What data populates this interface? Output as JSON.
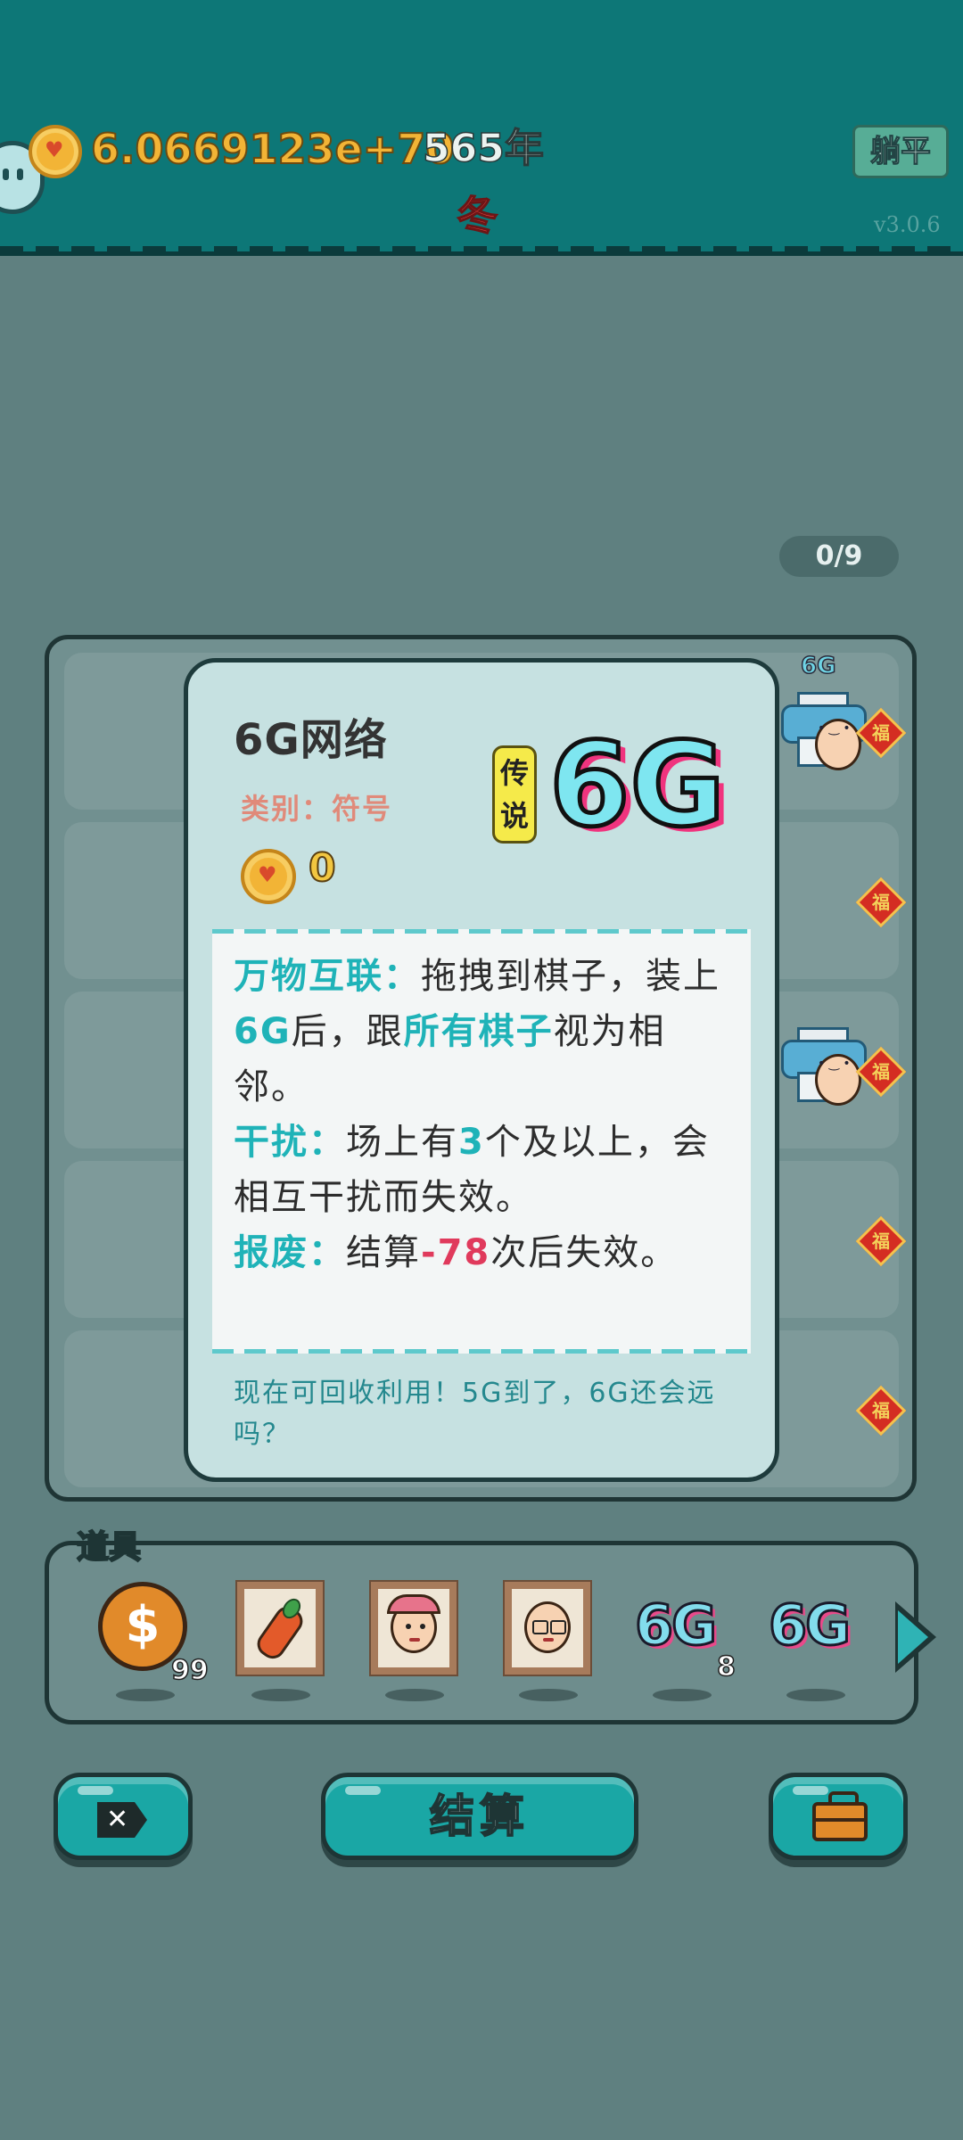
{
  "header": {
    "coins": "6.0669123e+70",
    "year": "565年",
    "season": "冬",
    "lie_flat_label": "躺平",
    "version": "v3.0.6"
  },
  "board": {
    "counter": "0/9",
    "fu_label": "福",
    "mini_6g_label": "6G"
  },
  "card": {
    "title": "6G网络",
    "category": "类别：符号",
    "price": "0",
    "rarity": "传说",
    "badge": "6G",
    "description": {
      "k1": "万物互联：",
      "t1": "拖拽到棋子，装上",
      "h1": "6G",
      "t2": "后，跟",
      "k2": "所有棋子",
      "t3": "视为相邻。",
      "k3": "干扰：",
      "t4": "场上有",
      "h2": "3",
      "t5": "个及以上，会相互干扰而失效。",
      "k4": "报废：",
      "t6": "结算",
      "neg": "-78",
      "t7": "次后失效。"
    },
    "footer": "现在可回收利用！5G到了，6G还会远吗？"
  },
  "items": {
    "label": "道具",
    "coin_count": "99",
    "sixg_label": "6G",
    "sixg_count": "8"
  },
  "buttons": {
    "settle": "结算",
    "close_tag": "✕"
  },
  "colors": {
    "header_bg": "#0d7777",
    "page_bg": "#5f8080",
    "card_bg": "#c6e1e1",
    "accent": "#1fb3b8",
    "negative": "#e03a5c",
    "coin": "#f2b436"
  }
}
